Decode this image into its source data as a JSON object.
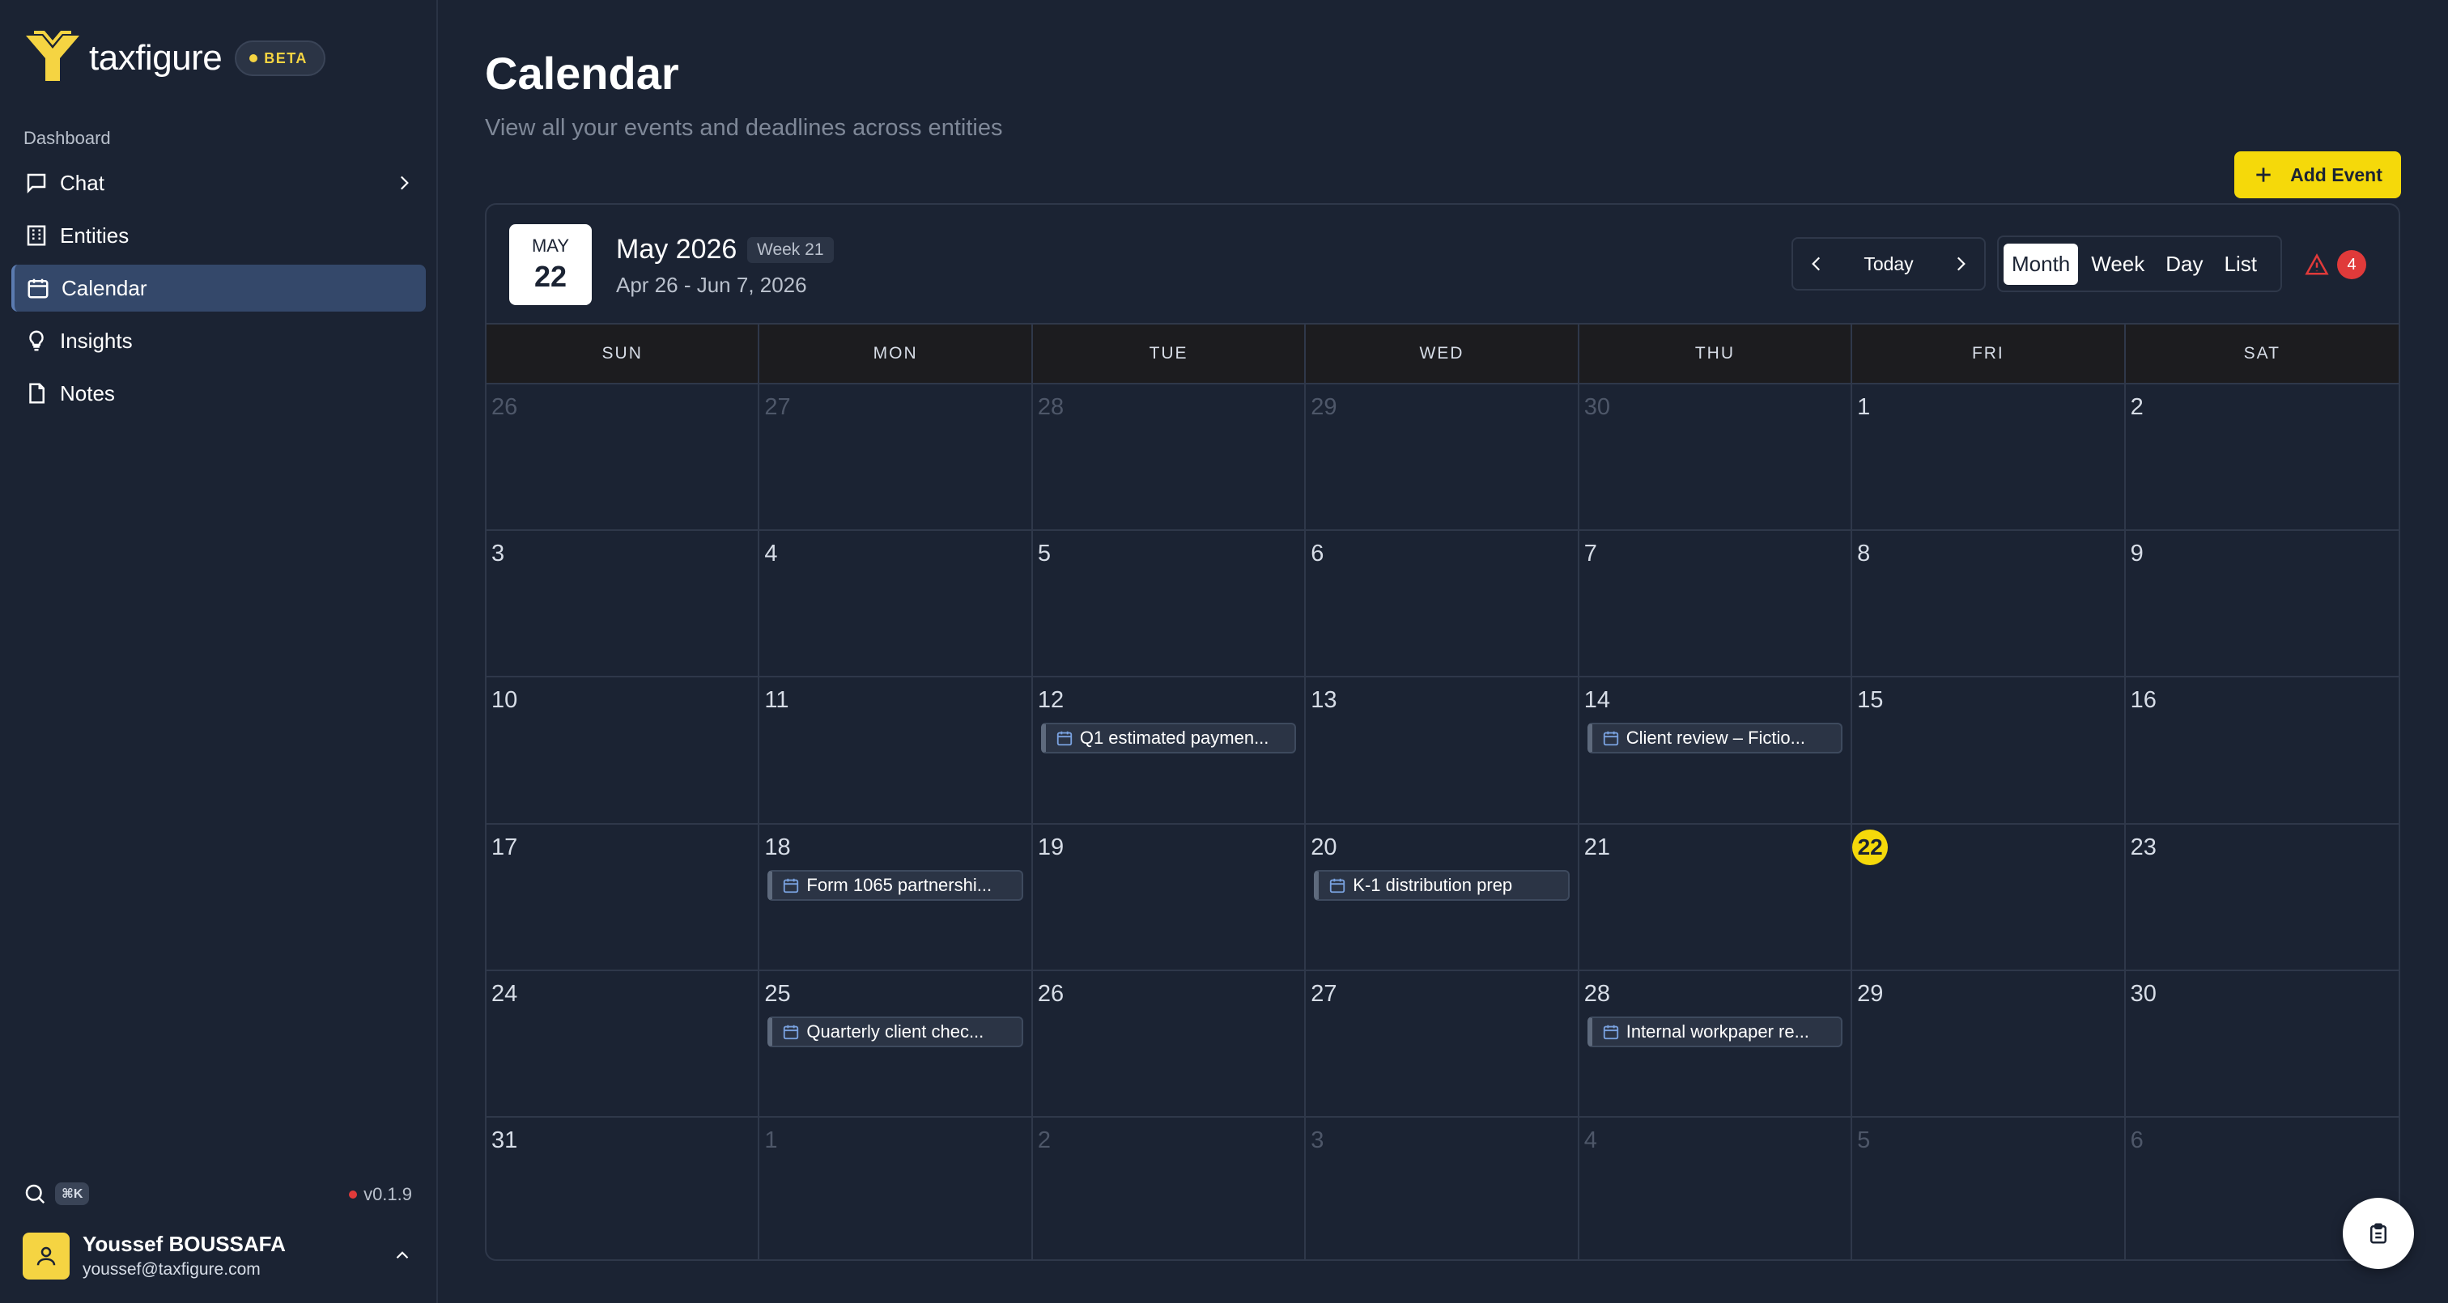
{
  "brand": {
    "name": "taxfigure",
    "badge": "BETA"
  },
  "sidebar": {
    "section_label": "Dashboard",
    "items": [
      {
        "label": "Chat",
        "icon": "chat-icon"
      },
      {
        "label": "Entities",
        "icon": "building-icon"
      },
      {
        "label": "Calendar",
        "icon": "calendar-icon",
        "active": true
      },
      {
        "label": "Insights",
        "icon": "lightbulb-icon"
      },
      {
        "label": "Notes",
        "icon": "file-icon"
      }
    ],
    "shortcut": "⌘K",
    "version": "v0.1.9",
    "user": {
      "name": "Youssef BOUSSAFA",
      "email": "youssef@taxfigure.com"
    }
  },
  "page": {
    "title": "Calendar",
    "subtitle": "View all your events and deadlines across entities",
    "add_event_label": "Add Event"
  },
  "calendar": {
    "badge_month": "MAY",
    "badge_day": "22",
    "month_title": "May 2026",
    "week_label": "Week 21",
    "range": "Apr 26 - Jun 7, 2026",
    "today_label": "Today",
    "views": [
      "Month",
      "Week",
      "Day",
      "List"
    ],
    "active_view": "Month",
    "alert_count": "4",
    "weekdays": [
      "SUN",
      "MON",
      "TUE",
      "WED",
      "THU",
      "FRI",
      "SAT"
    ],
    "weeks": [
      [
        {
          "d": "26",
          "m": true
        },
        {
          "d": "27",
          "m": true
        },
        {
          "d": "28",
          "m": true
        },
        {
          "d": "29",
          "m": true
        },
        {
          "d": "30",
          "m": true
        },
        {
          "d": "1"
        },
        {
          "d": "2"
        }
      ],
      [
        {
          "d": "3"
        },
        {
          "d": "4"
        },
        {
          "d": "5"
        },
        {
          "d": "6"
        },
        {
          "d": "7"
        },
        {
          "d": "8"
        },
        {
          "d": "9"
        }
      ],
      [
        {
          "d": "10"
        },
        {
          "d": "11"
        },
        {
          "d": "12",
          "event": "Q1 estimated paymen..."
        },
        {
          "d": "13"
        },
        {
          "d": "14",
          "event": "Client review – Fictio..."
        },
        {
          "d": "15"
        },
        {
          "d": "16"
        }
      ],
      [
        {
          "d": "17"
        },
        {
          "d": "18",
          "event": "Form 1065 partnershi..."
        },
        {
          "d": "19"
        },
        {
          "d": "20",
          "event": "K-1 distribution prep"
        },
        {
          "d": "21"
        },
        {
          "d": "22",
          "today": true
        },
        {
          "d": "23"
        }
      ],
      [
        {
          "d": "24"
        },
        {
          "d": "25",
          "event": "Quarterly client chec..."
        },
        {
          "d": "26"
        },
        {
          "d": "27"
        },
        {
          "d": "28",
          "event": "Internal workpaper re..."
        },
        {
          "d": "29"
        },
        {
          "d": "30"
        }
      ],
      [
        {
          "d": "31"
        },
        {
          "d": "1",
          "m": true
        },
        {
          "d": "2",
          "m": true
        },
        {
          "d": "3",
          "m": true
        },
        {
          "d": "4",
          "m": true
        },
        {
          "d": "5",
          "m": true
        },
        {
          "d": "6",
          "m": true
        }
      ]
    ]
  },
  "colors": {
    "accent": "#f5d90a",
    "background": "#1b2333",
    "active_nav": "#34486a",
    "alert": "#e03a3a"
  }
}
